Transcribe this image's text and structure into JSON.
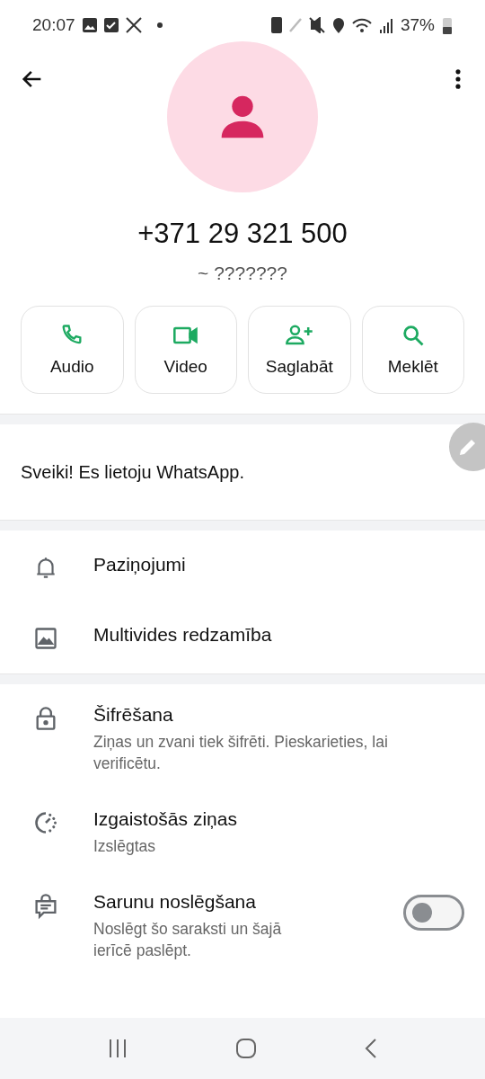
{
  "status_bar": {
    "time": "20:07",
    "battery": "37%"
  },
  "contact": {
    "phone": "+371 29 321 500",
    "name": "~ ???????"
  },
  "actions": [
    {
      "label": "Audio"
    },
    {
      "label": "Video"
    },
    {
      "label": "Saglabāt"
    },
    {
      "label": "Meklēt"
    }
  ],
  "about": {
    "text": "Sveiki! Es lietoju WhatsApp."
  },
  "media_items": [
    {
      "label": "Paziņojumi"
    },
    {
      "label": "Multivides redzamība"
    }
  ],
  "privacy_items": [
    {
      "kind": "subtitle",
      "label": "Šifrēšana",
      "subtitle": "Ziņas un zvani tiek šifrēti. Pieskarieties, lai verificētu."
    },
    {
      "kind": "subtitle",
      "label": "Izgaistošās ziņas",
      "subtitle": "Izslēgtas"
    },
    {
      "kind": "toggle",
      "label": "Sarunu noslēgšana",
      "subtitle": "Noslēgt šo saraksti un šajā ierīcē paslēpt.",
      "on": false
    }
  ]
}
